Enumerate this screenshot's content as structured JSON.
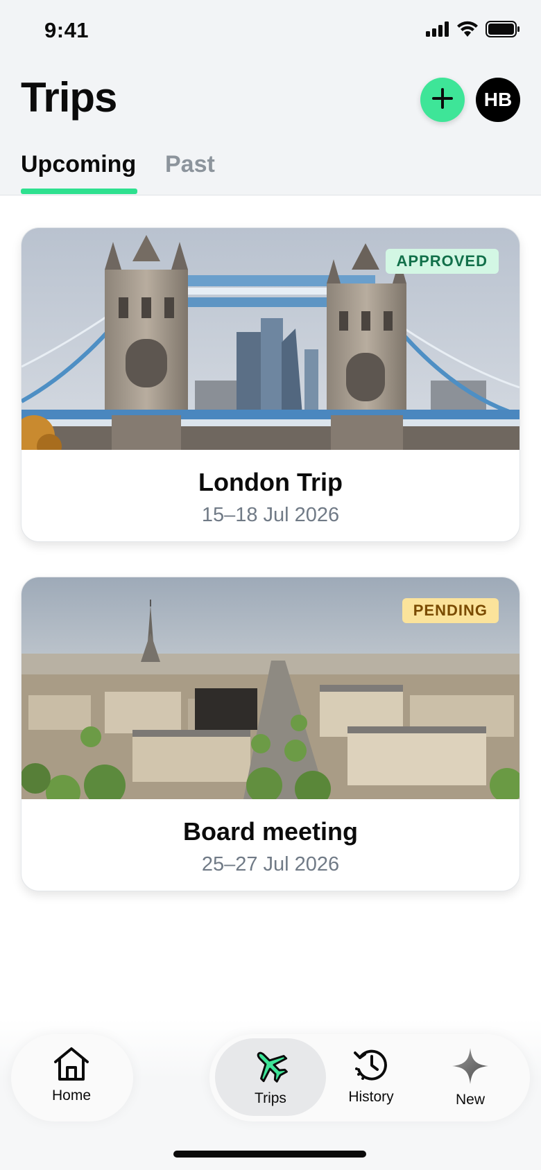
{
  "status_bar": {
    "time": "9:41"
  },
  "header": {
    "title": "Trips",
    "avatar_initials": "HB"
  },
  "tabs": [
    {
      "label": "Upcoming",
      "active": true
    },
    {
      "label": "Past",
      "active": false
    }
  ],
  "trips": [
    {
      "title": "London Trip",
      "dates": "15–18 Jul 2026",
      "status": "APPROVED",
      "image": "tower-bridge-london"
    },
    {
      "title": "Board meeting",
      "dates": "25–27 Jul 2026",
      "status": "PENDING",
      "image": "paris-eiffel-tower-aerial"
    }
  ],
  "bottom_nav": [
    {
      "label": "Home",
      "icon": "home-icon",
      "active": false
    },
    {
      "label": "Trips",
      "icon": "airplane-icon",
      "active": true
    },
    {
      "label": "History",
      "icon": "history-icon",
      "active": false
    },
    {
      "label": "New",
      "icon": "sparkle-icon",
      "active": false
    }
  ],
  "colors": {
    "accent": "#2ee08f",
    "approved_bg": "#d3f7e4",
    "approved_text": "#12704a",
    "pending_bg": "#fbe39b",
    "pending_text": "#7a4b00"
  }
}
